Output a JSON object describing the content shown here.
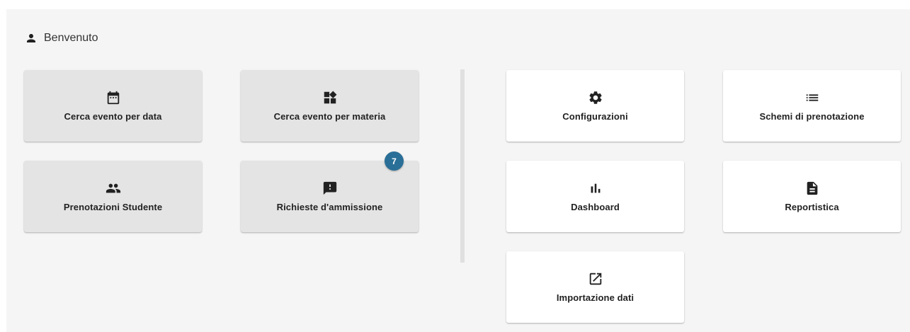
{
  "welcome": {
    "text": "Benvenuto",
    "icon": "person-icon"
  },
  "student_tiles": [
    {
      "label": "Cerca evento per data",
      "icon": "calendar-icon"
    },
    {
      "label": "Cerca evento per materia",
      "icon": "widgets-icon"
    },
    {
      "label": "Prenotazioni Studente",
      "icon": "people-icon"
    },
    {
      "label": "Richieste d'ammissione",
      "icon": "feedback-icon",
      "badge": "7"
    }
  ],
  "admin_tiles": [
    {
      "label": "Configurazioni",
      "icon": "gear-icon"
    },
    {
      "label": "Schemi di prenotazione",
      "icon": "list-icon"
    },
    {
      "label": "Dashboard",
      "icon": "bar-chart-icon"
    },
    {
      "label": "Reportistica",
      "icon": "document-icon"
    },
    {
      "label": "Importazione dati",
      "icon": "open-in-new-icon"
    }
  ],
  "colors": {
    "badge": "#2a6f97",
    "tile_grey": "#e4e4e4",
    "tile_white": "#ffffff",
    "panel": "#f5f5f5"
  }
}
